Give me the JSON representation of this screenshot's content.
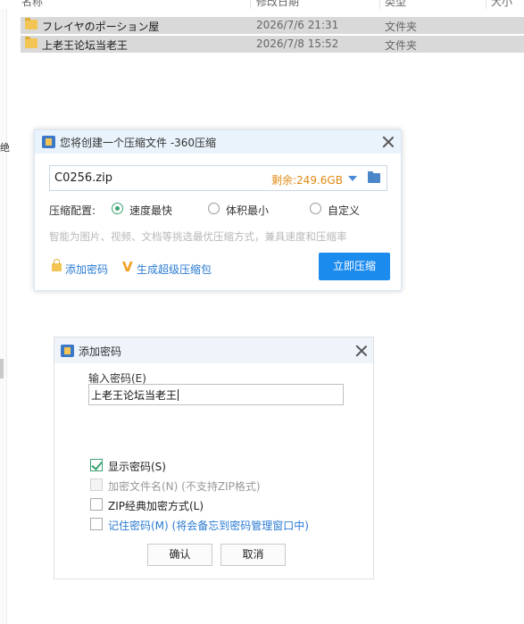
{
  "explorer": {
    "columns": [
      "名称",
      "修改日期",
      "类型",
      "大小"
    ],
    "rows": [
      {
        "name": "フレイヤのポーション屋",
        "date": "2026/7/6 21:31",
        "type": "文件夹"
      },
      {
        "name": "上老王论坛当老王",
        "date": "2026/7/8 15:52",
        "type": "文件夹"
      }
    ],
    "left_glyph": "绝"
  },
  "compress_dialog": {
    "title": "您将创建一个压缩文件 -360压缩",
    "icon": "app-icon",
    "archive_name": "C0256.zip",
    "free_space": "剩余:249.6GB",
    "config_label": "压缩配置:",
    "options": [
      {
        "label": "速度最快",
        "selected": true
      },
      {
        "label": "体积最小",
        "selected": false
      },
      {
        "label": "自定义",
        "selected": false
      }
    ],
    "hint": "智能为图片、视频、文档等挑选最优压缩方式，兼具速度和压缩率",
    "add_password_link": "添加密码",
    "super_archive_link": "生成超级压缩包",
    "compress_button": "立即压缩",
    "accent_color": "#1c8bee",
    "free_space_color": "#e08a13"
  },
  "password_dialog": {
    "title": "添加密码",
    "input_label": "输入密码(E)",
    "password_value": "上老王论坛当老王",
    "checkboxes": [
      {
        "label": "显示密码(S)",
        "checked": true,
        "disabled": false
      },
      {
        "label": "加密文件名(N) (不支持ZIP格式)",
        "checked": false,
        "disabled": true
      },
      {
        "label": "ZIP经典加密方式(L)",
        "checked": false,
        "disabled": false
      },
      {
        "label": "记住密码(M) (将会备忘到密码管理窗口中)",
        "checked": false,
        "disabled": false
      }
    ],
    "ok_button": "确认",
    "cancel_button": "取消"
  }
}
